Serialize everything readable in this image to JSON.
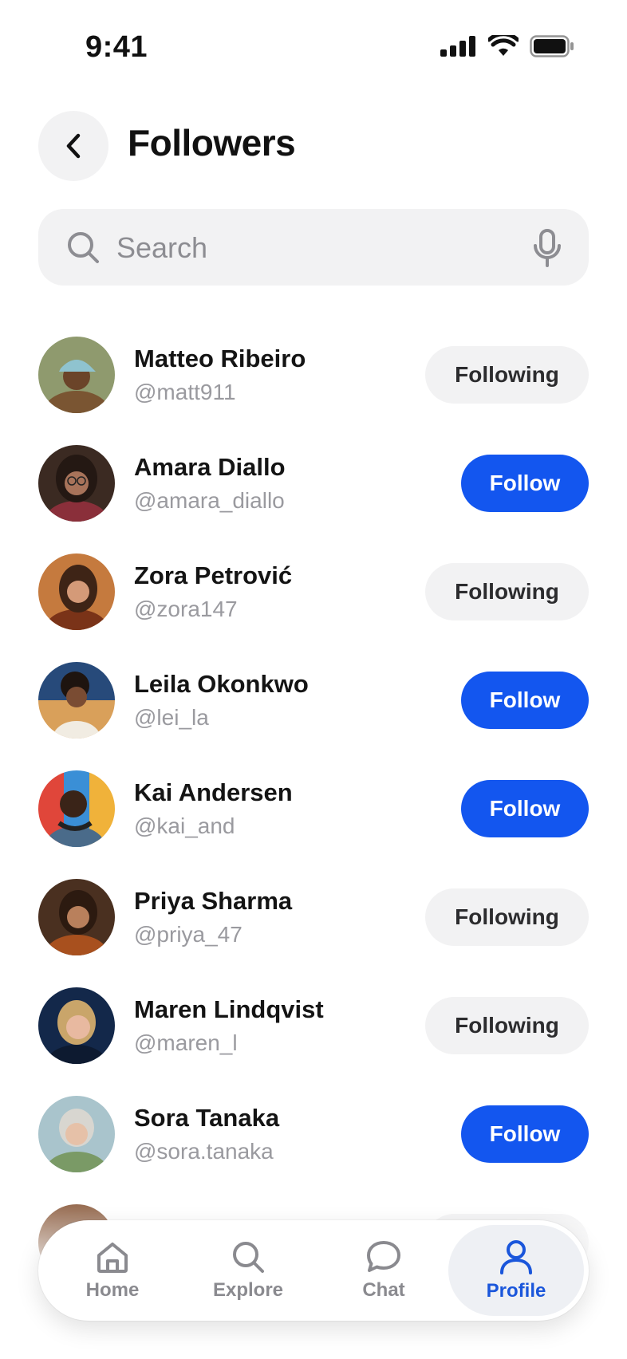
{
  "status_bar": {
    "time": "9:41"
  },
  "header": {
    "title": "Followers"
  },
  "search": {
    "placeholder": "Search"
  },
  "followers": [
    {
      "name": "Matteo Ribeiro",
      "handle": "@matt911",
      "button": "Following",
      "state": "following"
    },
    {
      "name": "Amara Diallo",
      "handle": "@amara_diallo",
      "button": "Follow",
      "state": "follow"
    },
    {
      "name": "Zora Petrović",
      "handle": "@zora147",
      "button": "Following",
      "state": "following"
    },
    {
      "name": "Leila Okonkwo",
      "handle": "@lei_la",
      "button": "Follow",
      "state": "follow"
    },
    {
      "name": "Kai Andersen",
      "handle": "@kai_and",
      "button": "Follow",
      "state": "follow"
    },
    {
      "name": "Priya Sharma",
      "handle": "@priya_47",
      "button": "Following",
      "state": "following"
    },
    {
      "name": "Maren Lindqvist",
      "handle": "@maren_l",
      "button": "Following",
      "state": "following"
    },
    {
      "name": "Sora Tanaka",
      "handle": "@sora.tanaka",
      "button": "Follow",
      "state": "follow"
    }
  ],
  "tab_bar": {
    "tabs": [
      {
        "label": "Home",
        "icon": "home-icon"
      },
      {
        "label": "Explore",
        "icon": "search-icon"
      },
      {
        "label": "Chat",
        "icon": "chat-bubble-icon"
      },
      {
        "label": "Profile",
        "icon": "user-icon"
      }
    ],
    "active": "Profile"
  },
  "colors": {
    "accent": "#1356ef",
    "chip_bg": "#f2f2f3",
    "active_tab": "#1a56db",
    "muted_text": "#9a9a9f"
  }
}
